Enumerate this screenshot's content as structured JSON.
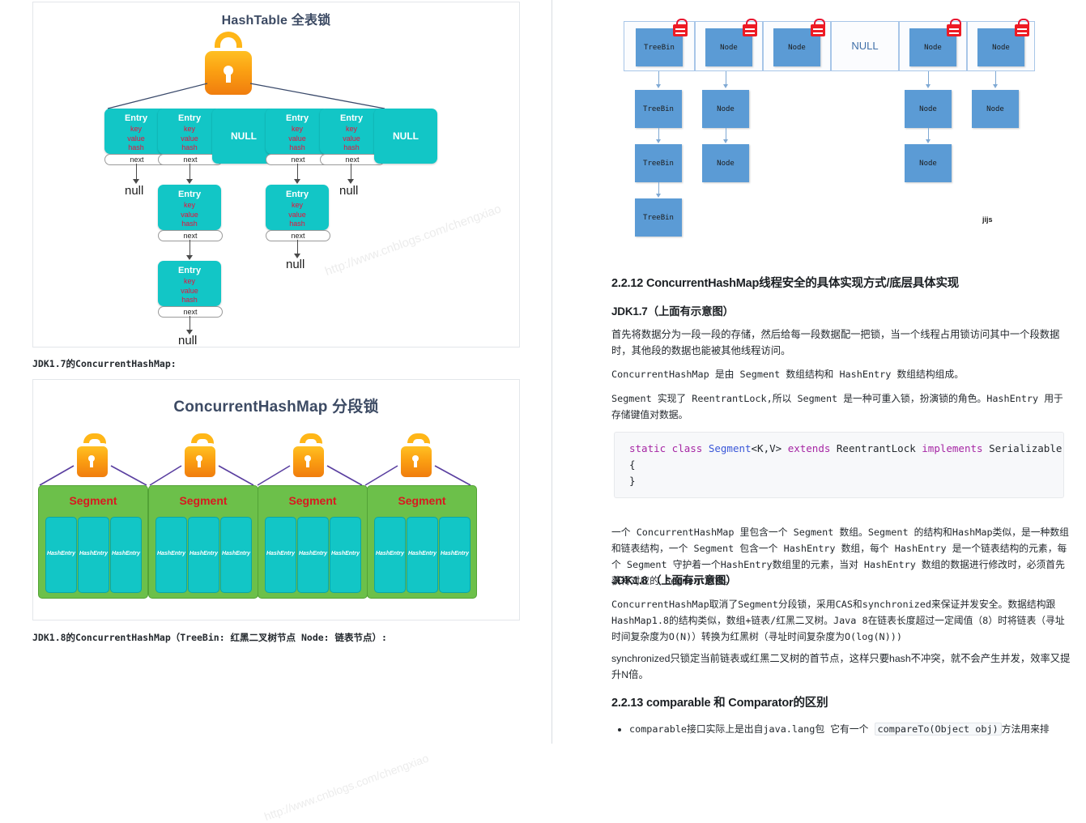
{
  "figure_hashtable": {
    "title": "HashTable 全表锁",
    "watermark": "http://www.cnblogs.com/chengxiao",
    "lock_icon": "padlock-icon",
    "buckets": [
      {
        "type": "entry",
        "title": "Entry",
        "fields": "key\nvalue\nhash",
        "next_label": "next"
      },
      {
        "type": "entry",
        "title": "Entry",
        "fields": "key\nvalue\nhash",
        "next_label": "next"
      },
      {
        "type": "null",
        "label": "NULL"
      },
      {
        "type": "entry",
        "title": "Entry",
        "fields": "key\nvalue\nhash",
        "next_label": "next"
      },
      {
        "type": "entry",
        "title": "Entry",
        "fields": "key\nvalue\nhash",
        "next_label": "next"
      },
      {
        "type": "null",
        "label": "NULL"
      }
    ],
    "entry_title": "Entry",
    "field_key": "key",
    "field_value": "value",
    "field_hash": "hash",
    "next_label": "next",
    "null_word": "null",
    "null_box_label": "NULL"
  },
  "caption_1": "JDK1.7的ConcurrentHashMap:",
  "figure_segments": {
    "title": "ConcurrentHashMap 分段锁",
    "watermark": "http://www.cnblogs.com/chengxiao",
    "segment_label": "Segment",
    "hashentry_label": "HashEntry",
    "segment_count": 4,
    "hashentry_per_segment": 3,
    "colors": {
      "segment_fill": "#6cc04a",
      "hashentry_fill": "#12c6c6",
      "segment_text": "#d81920"
    }
  },
  "caption_2": "JDK1.8的ConcurrentHashMap（TreeBin: 红黑二叉树节点 Node: 链表节点）:",
  "figure_jdk18": {
    "watermark": "jijs",
    "lock_icon": "red-padlock-icon",
    "columns": [
      {
        "head": "TreeBin",
        "locked": true,
        "chain": [
          "TreeBin",
          "TreeBin",
          "TreeBin"
        ]
      },
      {
        "head": "Node",
        "locked": true,
        "chain": [
          "Node",
          "Node"
        ]
      },
      {
        "head": "Node",
        "locked": true,
        "chain": []
      },
      {
        "head": "NULL",
        "locked": false,
        "chain": []
      },
      {
        "head": "Node",
        "locked": true,
        "chain": [
          "Node",
          "Node"
        ]
      },
      {
        "head": "Node",
        "locked": true,
        "chain": [
          "Node"
        ]
      }
    ],
    "colors": {
      "node_fill": "#5b9bd5",
      "cell_border": "#a8c6e8",
      "lock": "#ee1b24"
    }
  },
  "article": {
    "section_2212": "2.2.12 ConcurrentHashMap线程安全的具体实现方式/底层具体实现",
    "jdk17_heading": "JDK1.7（上面有示意图）",
    "p1": "首先将数据分为一段一段的存储，然后给每一段数据配一把锁，当一个线程占用锁访问其中一个段数据时，其他段的数据也能被其他线程访问。",
    "p2": "ConcurrentHashMap 是由 Segment 数组结构和 HashEntry 数组结构组成。",
    "p3": "Segment 实现了 ReentrantLock,所以 Segment 是一种可重入锁，扮演锁的角色。HashEntry 用于存储键值对数据。",
    "code": {
      "line1_a": "static class ",
      "line1_b": "Segment",
      "line1_c": "<K,V> ",
      "line1_d": "extends ",
      "line1_e": "ReentrantLock ",
      "line1_f": "implements ",
      "line1_g": "Serializable",
      "line2": "{",
      "line3": "}"
    },
    "p4": "一个 ConcurrentHashMap 里包含一个 Segment 数组。Segment 的结构和HashMap类似，是一种数组和链表结构，一个 Segment 包含一个 HashEntry 数组，每个 HashEntry 是一个链表结构的元素，每个 Segment 守护着一个HashEntry数组里的元素，当对 HashEntry 数组的数据进行修改时，必须首先获得对应的 Segment的锁。",
    "jdk18_heading": "JDK1.8 （上面有示意图）",
    "p5": "ConcurrentHashMap取消了Segment分段锁，采用CAS和synchronized来保证并发安全。数据结构跟HashMap1.8的结构类似，数组+链表/红黑二叉树。Java 8在链表长度超过一定阈值（8）时将链表（寻址时间复杂度为O(N)）转换为红黑树（寻址时间复杂度为O(log(N)))",
    "p6": "synchronized只锁定当前链表或红黑二叉树的首节点，这样只要hash不冲突，就不会产生并发，效率又提升N倍。",
    "section_2213": "2.2.13 comparable 和 Comparator的区别",
    "bullet1_a": "comparable接口实际上是出自java.lang包 它有一个 ",
    "bullet1_code": "compareTo(Object obj)",
    "bullet1_b": "方法用来排"
  }
}
